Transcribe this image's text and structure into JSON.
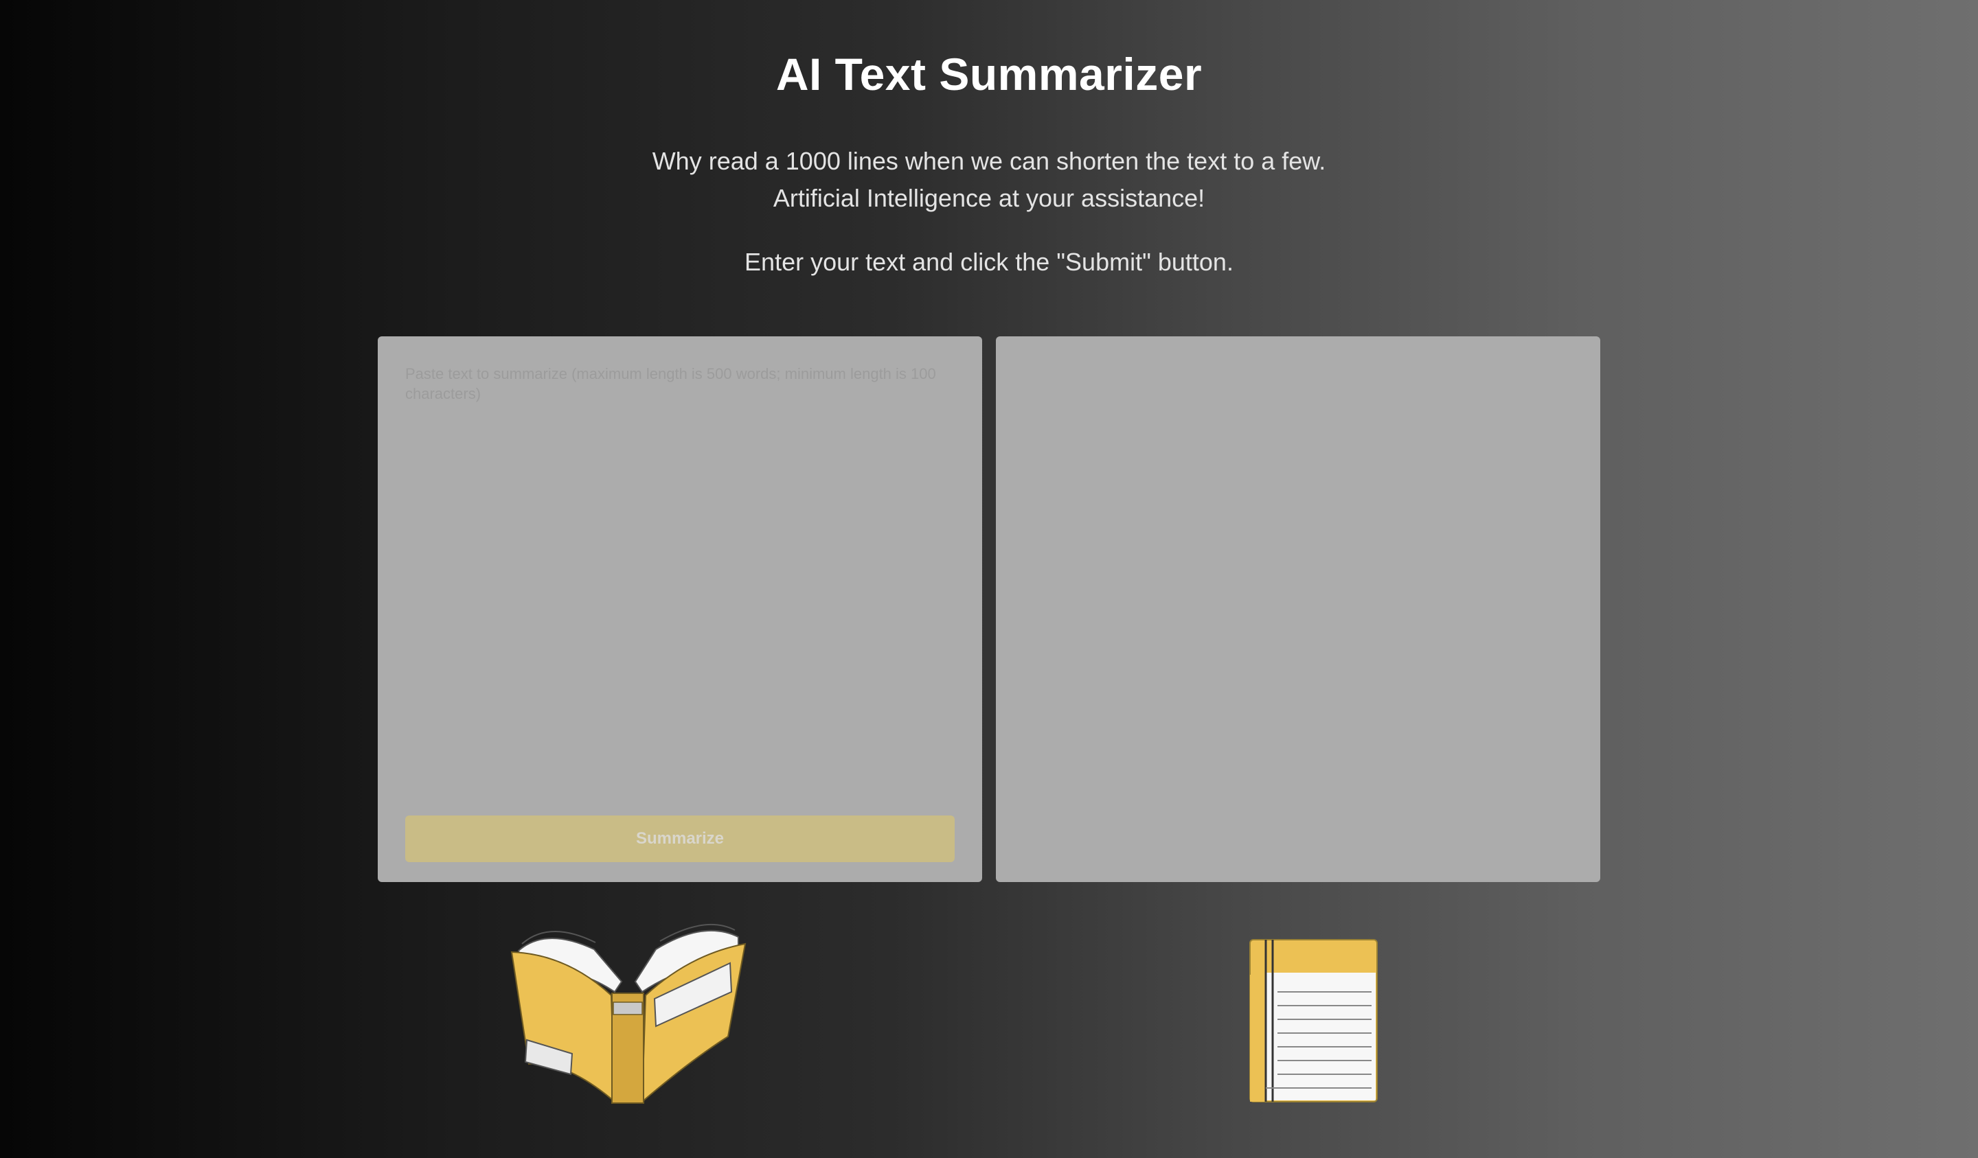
{
  "header": {
    "title": "AI Text Summarizer",
    "tagline_line1": "Why read a 1000 lines when we can shorten the text to a few.",
    "tagline_line2": "Artificial Intelligence at your assistance!",
    "instruction": "Enter your text and click the \"Submit\" button."
  },
  "input_panel": {
    "placeholder": "Paste text to summarize (maximum length is 500 words; minimum length is 100 characters)",
    "value": "",
    "button_label": "Summarize"
  },
  "output_panel": {
    "summary_text": ""
  },
  "illustrations": {
    "left": "open-book-icon",
    "right": "notepad-icon"
  },
  "colors": {
    "accent_yellow": "#ecc154",
    "button_bg": "#c9bc86",
    "panel_bg": "#acacac"
  }
}
